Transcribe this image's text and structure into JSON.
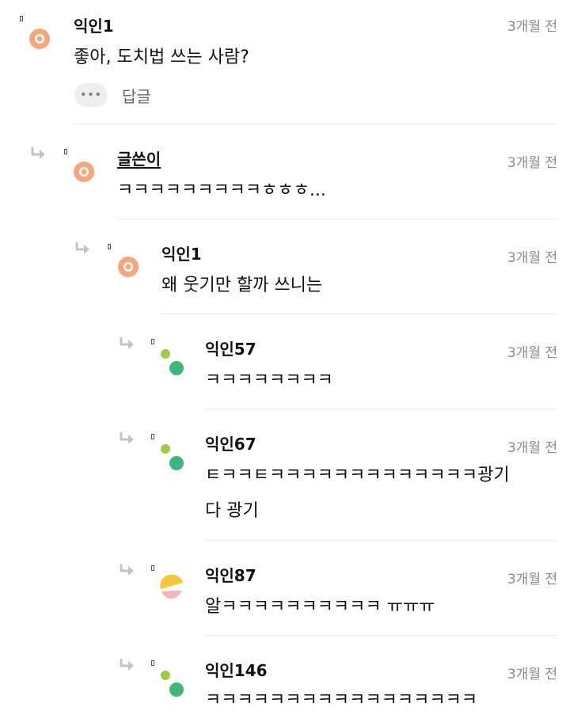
{
  "comments": [
    {
      "author": "익인1",
      "time": "3개월 전",
      "lines": [
        "좋아, 도치법 쓰는 사람?"
      ],
      "avatar": "orange",
      "op": false
    },
    {
      "author": "글쓴이",
      "time": "3개월 전",
      "lines": [
        "ㅋㅋㅋㅋㅋㅋㅋㅋㅋㅎㅎㅎ..."
      ],
      "avatar": "orange",
      "op": true
    },
    {
      "author": "익인1",
      "time": "3개월 전",
      "lines": [
        "왜 웃기만 할까 쓰니는"
      ],
      "avatar": "orange",
      "op": false
    },
    {
      "author": "익인57",
      "time": "3개월 전",
      "lines": [
        "ㅋㅋㅋㅋㅋㅋㅋㅋ"
      ],
      "avatar": "green",
      "op": false
    },
    {
      "author": "익인67",
      "time": "3개월 전",
      "lines": [
        "ㅌㅋㅋㅌㅋㅋㅋㅋㅋㅋㅋㅋㅋㅋㅋㅋㅋ광기",
        "다 광기"
      ],
      "avatar": "green",
      "op": false
    },
    {
      "author": "익인87",
      "time": "3개월 전",
      "lines": [
        "알ㅋㅋㅋㅋㅋㅋㅋㅋㅋㅋ ㅠㅠㅠ"
      ],
      "avatar": "yellowpink",
      "op": false
    },
    {
      "author": "익인146",
      "time": "3개월 전",
      "lines": [
        "ㅋㅋㅋㅋㅋㅋㅋㅋㅋㅋㅋㅋㅋㅋㅋㅋㅋ"
      ],
      "avatar": "green",
      "op": false
    }
  ],
  "actions": {
    "more_label": "•••",
    "reply_label": "답글"
  },
  "icons": {
    "reply_arrow": "reply-arrow-icon",
    "more": "more-icon"
  },
  "colors": {
    "orange": "#f4a77f",
    "green_light": "#9ccc49",
    "green_dark": "#3bb77a",
    "yellow": "#f6c53b",
    "pink": "#f3b5be",
    "divider": "#e8e8e8",
    "time": "#8a8a8a"
  }
}
